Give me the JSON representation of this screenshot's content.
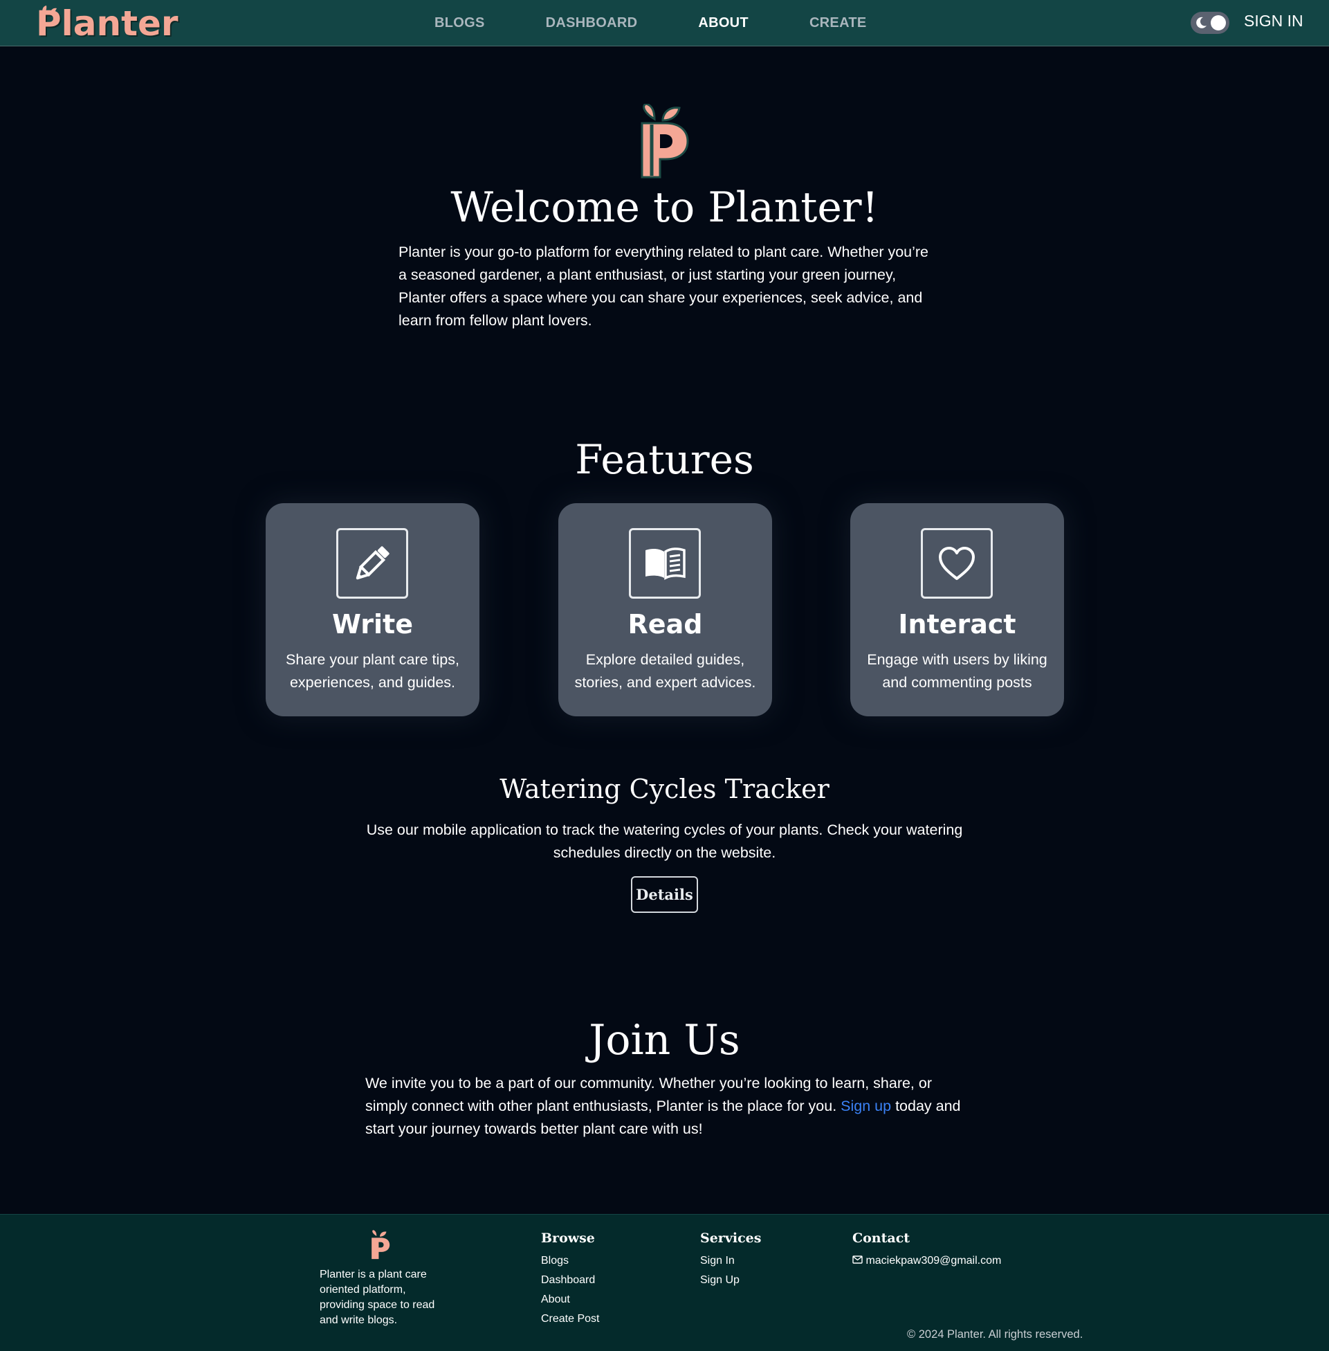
{
  "header": {
    "brand": "Planter",
    "nav": [
      {
        "label": "BLOGS",
        "active": false
      },
      {
        "label": "DASHBOARD",
        "active": false
      },
      {
        "label": "ABOUT",
        "active": true
      },
      {
        "label": "CREATE",
        "active": false
      }
    ],
    "theme_toggle_icon": "moon-icon",
    "signin_label": "SIGN IN"
  },
  "hero": {
    "title": "Welcome to Planter!",
    "intro": "Planter is your go-to platform for everything related to plant care. Whether you’re a seasoned gardener, a plant enthusiast, or just starting your green journey, Planter offers a space where you can share your experiences, seek advice, and learn from fellow plant lovers."
  },
  "features": {
    "title": "Features",
    "cards": [
      {
        "icon": "pencil-icon",
        "title": "Write",
        "desc": "Share your plant care tips, experiences, and guides."
      },
      {
        "icon": "book-icon",
        "title": "Read",
        "desc": "Explore detailed guides, stories, and expert advices."
      },
      {
        "icon": "heart-icon",
        "title": "Interact",
        "desc": "Engage with users by liking and commenting posts"
      }
    ]
  },
  "watering": {
    "title": "Watering Cycles Tracker",
    "desc": "Use our mobile application to track the watering cycles of your plants. Check your watering schedules directly on the website.",
    "button": "Details"
  },
  "join": {
    "title": "Join Us",
    "text_before": "We invite you to be a part of our community. Whether you’re looking to learn, share, or simply connect with other plant enthusiasts, Planter is the place for you. ",
    "link": "Sign up",
    "text_after": " today and start your journey towards better plant care with us!"
  },
  "footer": {
    "about": "Planter is a plant care oriented platform, providing space to read and write blogs.",
    "browse": {
      "title": "Browse",
      "links": [
        "Blogs",
        "Dashboard",
        "About",
        "Create Post"
      ]
    },
    "services": {
      "title": "Services",
      "links": [
        "Sign In",
        "Sign Up"
      ]
    },
    "contact": {
      "title": "Contact",
      "email": "maciekpaw309@gmail.com",
      "email_icon": "mail-icon"
    },
    "copyright": "© 2024 Planter. All rights reserved."
  },
  "colors": {
    "header_bg": "#134545",
    "page_bg": "#030914",
    "brand_pink": "#f4a795",
    "card_bg": "#4c5563",
    "link_blue": "#3b82f6",
    "footer_bg": "#042a2b"
  }
}
